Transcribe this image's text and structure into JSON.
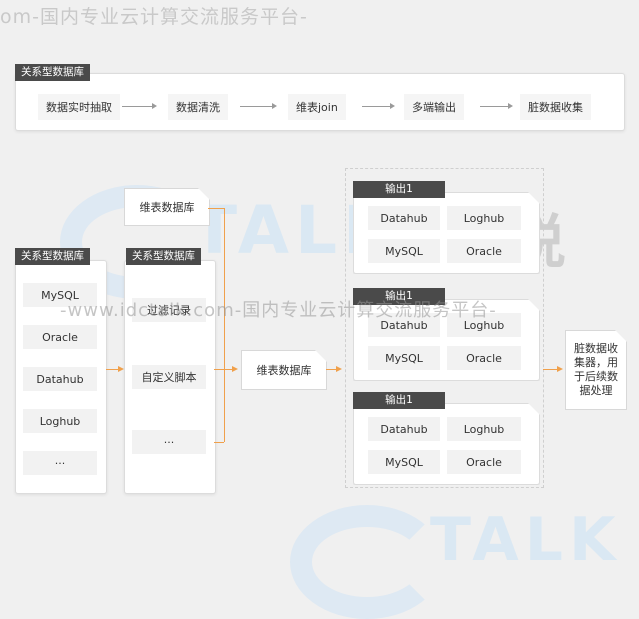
{
  "watermark": {
    "top_text": "om-国内专业云计算交流服务平台-",
    "mid_text": "-www.idctalk.com-国内专业云计算交流服务平台-",
    "logo_text": "TALK",
    "logo_cn": "云说",
    "logo_bottom": "TALK"
  },
  "top_panel": {
    "tag": "关系型数据库",
    "steps": [
      "数据实时抽取",
      "数据清洗",
      "维表join",
      "多端输出",
      "脏数据收集"
    ]
  },
  "source_panel": {
    "tag": "关系型数据库",
    "items": [
      "MySQL",
      "Oracle",
      "Datahub",
      "Loghub",
      "···"
    ]
  },
  "process_panel": {
    "tag": "关系型数据库",
    "items": [
      "过滤记录",
      "自定义脚本",
      "···"
    ]
  },
  "dim_table_top": "维表数据库",
  "dim_table_mid": "维表数据库",
  "outputs": [
    {
      "tag": "输出1",
      "items": [
        "Datahub",
        "Loghub",
        "MySQL",
        "Oracle"
      ]
    },
    {
      "tag": "输出1",
      "items": [
        "Datahub",
        "Loghub",
        "MySQL",
        "Oracle"
      ]
    },
    {
      "tag": "输出1",
      "items": [
        "Datahub",
        "Loghub",
        "MySQL",
        "Oracle"
      ]
    }
  ],
  "dirty_collector": "脏数据收集器，用于后续数据处理",
  "colors": {
    "arrow_orange": "#f0a04b",
    "tag_dark": "#4a4a4a",
    "arrow_gray": "#9a9a9a"
  }
}
